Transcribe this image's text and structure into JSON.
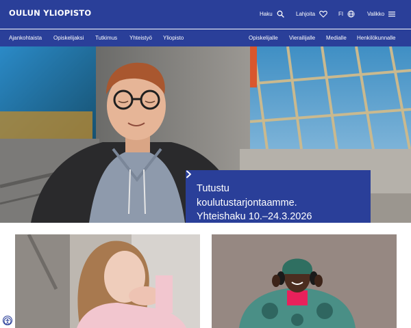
{
  "brand": {
    "logo_text": "OULUN YLIOPISTO",
    "primary_color": "#2a3f99"
  },
  "utility": {
    "search_label": "Haku",
    "donate_label": "Lahjoita",
    "language_label": "FI",
    "menu_label": "Valikko",
    "icons": [
      "search-icon",
      "heart-icon",
      "globe-icon",
      "hamburger-icon"
    ]
  },
  "nav": {
    "primary": [
      "Ajankohtaista",
      "Opiskelijaksi",
      "Tutkimus",
      "Yhteistyö",
      "Yliopisto"
    ],
    "audience": [
      "Opiskelijalle",
      "Vierailijalle",
      "Medialle",
      "Henkilökunnalle"
    ]
  },
  "hero": {
    "cta_lines": [
      "Tutustu",
      "koulutustarjontaamme.",
      "Yhteishaku 10.–24.3.2026"
    ],
    "cta_icon": "chevron-right-icon"
  },
  "a11y": {
    "icon": "accessibility-icon"
  }
}
